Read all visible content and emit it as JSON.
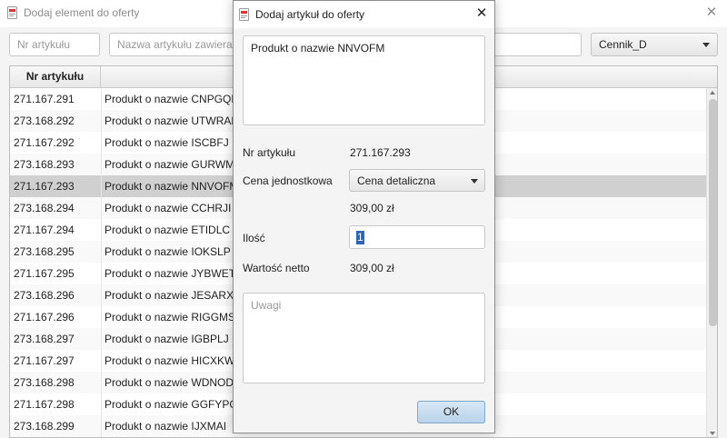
{
  "main": {
    "title": "Dodaj element do oferty",
    "filter_number_placeholder": "Nr artykułu",
    "filter_name_placeholder": "Nazwa artykułu zawiera...",
    "pricelist_selected": "Cennik_D",
    "columns": [
      "Nr artykułu",
      ""
    ],
    "rows": [
      {
        "number": "271.167.291",
        "name": "Produkt o nazwie CNPGQM"
      },
      {
        "number": "273.168.292",
        "name": "Produkt o nazwie UTWRAN"
      },
      {
        "number": "271.167.292",
        "name": "Produkt o nazwie ISCBFJ"
      },
      {
        "number": "273.168.293",
        "name": "Produkt o nazwie GURWMI"
      },
      {
        "number": "271.167.293",
        "name": "Produkt o nazwie NNVOFM"
      },
      {
        "number": "273.168.294",
        "name": "Produkt o nazwie CCHRJI"
      },
      {
        "number": "271.167.294",
        "name": "Produkt o nazwie ETIDLC"
      },
      {
        "number": "273.168.295",
        "name": "Produkt o nazwie IOKSLP"
      },
      {
        "number": "271.167.295",
        "name": "Produkt o nazwie JYBWET"
      },
      {
        "number": "273.168.296",
        "name": "Produkt o nazwie JESARX"
      },
      {
        "number": "271.167.296",
        "name": "Produkt o nazwie RIGGMS"
      },
      {
        "number": "273.168.297",
        "name": "Produkt o nazwie IGBPLJ"
      },
      {
        "number": "271.167.297",
        "name": "Produkt o nazwie HICXKW"
      },
      {
        "number": "273.168.298",
        "name": "Produkt o nazwie WDNODI"
      },
      {
        "number": "271.167.298",
        "name": "Produkt o nazwie GGFYPG"
      },
      {
        "number": "273.168.299",
        "name": "Produkt o nazwie IJXMAI"
      }
    ],
    "selected_row_index": 4
  },
  "dialog": {
    "title": "Dodaj artykuł do oferty",
    "product_name": "Produkt o nazwie NNVOFM",
    "number_label": "Nr artykułu",
    "number_value": "271.167.293",
    "price_label": "Cena jednostkowa",
    "price_type": "Cena detaliczna",
    "unit_price": "309,00 zł",
    "quantity_label": "Ilość",
    "quantity_value": "1",
    "net_label": "Wartość netto",
    "net_value": "309,00 zł",
    "notes_placeholder": "Uwagi",
    "ok_label": "OK"
  },
  "icons": {
    "app": "document-icon",
    "close": "close-icon",
    "dropdown": "chevron-down-icon"
  },
  "colors": {
    "selection": "#d0d0d0",
    "text_selection": "#2f66b3",
    "ok_button": "#c6ddf0"
  }
}
